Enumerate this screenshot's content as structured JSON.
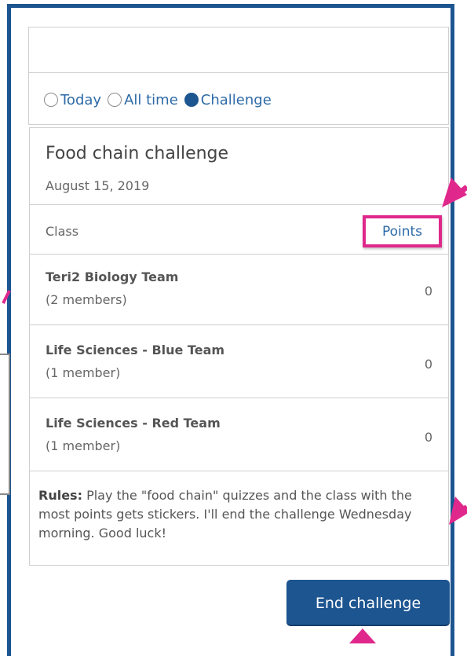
{
  "filters": {
    "options": [
      {
        "label": "Today",
        "checked": false
      },
      {
        "label": "All time",
        "checked": false
      },
      {
        "label": "Challenge",
        "checked": true
      }
    ]
  },
  "challenge": {
    "title": "Food chain challenge",
    "date": "August 15, 2019",
    "columns": {
      "class": "Class",
      "points": "Points"
    },
    "teams": [
      {
        "name": "Teri2 Biology Team",
        "members": "(2 members)",
        "points": "0"
      },
      {
        "name": "Life Sciences - Blue Team",
        "members": "(1 member)",
        "points": "0"
      },
      {
        "name": "Life Sciences - Red Team",
        "members": "(1 member)",
        "points": "0"
      }
    ],
    "rules_label": "Rules:",
    "rules_text": "Play the \"food chain\" quizzes and the class with the most points gets stickers. I'll end the challenge Wednesday morning. Good luck!"
  },
  "actions": {
    "end_label": "End challenge"
  },
  "colors": {
    "accent": "#1d5590",
    "highlight": "#e0288c",
    "link": "#2d6aa8"
  }
}
